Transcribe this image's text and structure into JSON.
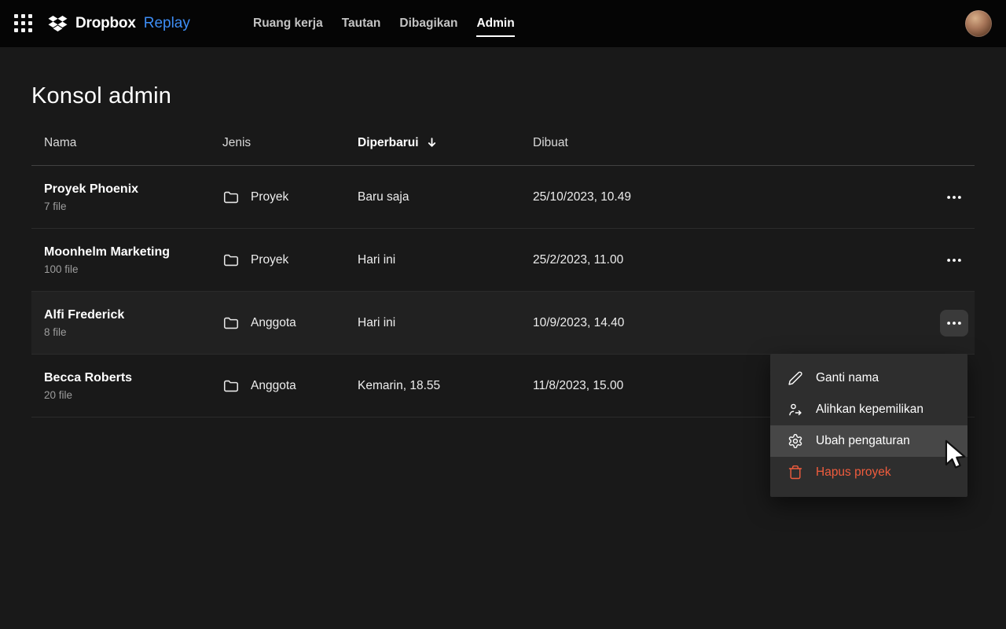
{
  "topbar": {
    "brand": {
      "name": "Dropbox",
      "product": "Replay"
    },
    "nav": [
      {
        "label": "Ruang kerja",
        "active": false
      },
      {
        "label": "Tautan",
        "active": false
      },
      {
        "label": "Dibagikan",
        "active": false
      },
      {
        "label": "Admin",
        "active": true
      }
    ]
  },
  "page": {
    "title": "Konsol admin"
  },
  "table": {
    "headers": {
      "name": "Nama",
      "type": "Jenis",
      "updated": "Diperbarui",
      "created": "Dibuat"
    },
    "sort": {
      "column": "Diperbarui",
      "direction": "desc",
      "icon": "arrow-down-icon"
    },
    "rows": [
      {
        "name": "Proyek Phoenix",
        "files": "7 file",
        "type": "Proyek",
        "updated": "Baru saja",
        "created": "25/10/2023, 10.49",
        "icon": "folder-icon"
      },
      {
        "name": "Moonhelm Marketing",
        "files": "100 file",
        "type": "Proyek",
        "updated": "Hari ini",
        "created": "25/2/2023, 11.00",
        "icon": "folder-icon"
      },
      {
        "name": "Alfi Frederick",
        "files": "8 file",
        "type": "Anggota",
        "updated": "Hari ini",
        "created": "10/9/2023, 14.40",
        "icon": "folder-icon"
      },
      {
        "name": "Becca Roberts",
        "files": "20 file",
        "type": "Anggota",
        "updated": "Kemarin, 18.55",
        "created": "11/8/2023, 15.00",
        "icon": "folder-icon"
      }
    ]
  },
  "context_menu": {
    "items": [
      {
        "label": "Ganti nama",
        "icon": "pencil-icon",
        "state": "normal"
      },
      {
        "label": "Alihkan kepemilikan",
        "icon": "transfer-ownership-icon",
        "state": "normal"
      },
      {
        "label": "Ubah pengaturan",
        "icon": "gear-icon",
        "state": "hovered"
      },
      {
        "label": "Hapus proyek",
        "icon": "trash-icon",
        "state": "danger"
      }
    ]
  },
  "colors": {
    "accent_blue": "#3d8df5",
    "danger": "#f05c3d",
    "topbar_bg": "#050505",
    "page_bg": "#191919",
    "menu_bg": "#2e2e2e",
    "menu_hover": "#474747"
  }
}
